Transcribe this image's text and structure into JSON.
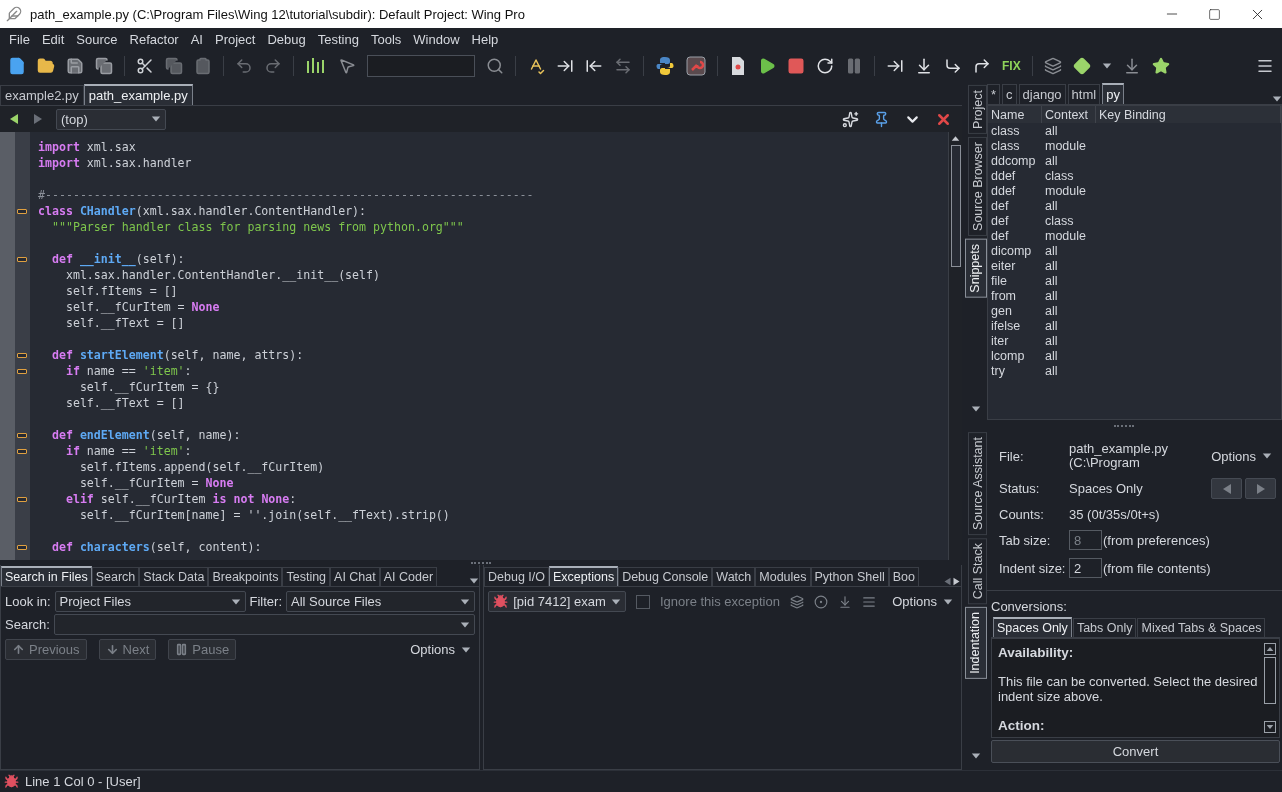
{
  "window": {
    "title": "path_example.py (C:\\Program Files\\Wing 12\\tutorial\\subdir): Default Project: Wing Pro"
  },
  "menu": [
    "File",
    "Edit",
    "Source",
    "Refactor",
    "AI",
    "Project",
    "Debug",
    "Testing",
    "Tools",
    "Window",
    "Help"
  ],
  "toolbar": {
    "fix_label": "FIX"
  },
  "editor": {
    "tabs": [
      {
        "label": "example2.py",
        "selected": false
      },
      {
        "label": "path_example.py",
        "selected": true
      }
    ],
    "scope": "(top)",
    "lines": [
      {
        "fold": false,
        "segments": [
          {
            "kind": "kw",
            "text": "import"
          },
          {
            "kind": "plain",
            "text": " xml.sax"
          }
        ]
      },
      {
        "fold": false,
        "segments": [
          {
            "kind": "kw",
            "text": "import"
          },
          {
            "kind": "plain",
            "text": " xml.sax.handler"
          }
        ]
      },
      {
        "fold": false
      },
      {
        "fold": false,
        "segments": [
          {
            "kind": "comment",
            "text": "#----------------------------------------------------------------------"
          }
        ]
      },
      {
        "fold": true,
        "segments": [
          {
            "kind": "kw",
            "text": "class "
          },
          {
            "kind": "fn",
            "text": "CHandler"
          },
          {
            "kind": "plain",
            "text": "(xml.sax.handler.ContentHandler):"
          }
        ]
      },
      {
        "fold": false,
        "segments": [
          {
            "kind": "str",
            "text": "  \"\"\"Parser handler class for parsing news from python.org\"\"\""
          }
        ]
      },
      {
        "fold": false
      },
      {
        "fold": true,
        "segments": [
          {
            "kind": "kw",
            "text": "  def "
          },
          {
            "kind": "fn",
            "text": "__init__"
          },
          {
            "kind": "plain",
            "text": "(self):"
          }
        ]
      },
      {
        "fold": false,
        "segments": [
          {
            "kind": "plain",
            "text": "    xml.sax.handler.ContentHandler.__init__(self)"
          }
        ]
      },
      {
        "fold": false,
        "segments": [
          {
            "kind": "plain",
            "text": "    self.fItems = []"
          }
        ]
      },
      {
        "fold": false,
        "segments": [
          {
            "kind": "plain",
            "text": "    self.__fCurItem = "
          },
          {
            "kind": "kw",
            "text": "None"
          }
        ]
      },
      {
        "fold": false,
        "segments": [
          {
            "kind": "plain",
            "text": "    self.__fText = []"
          }
        ]
      },
      {
        "fold": false
      },
      {
        "fold": true,
        "segments": [
          {
            "kind": "kw",
            "text": "  def "
          },
          {
            "kind": "fn",
            "text": "startElement"
          },
          {
            "kind": "plain",
            "text": "(self, name, attrs):"
          }
        ]
      },
      {
        "fold": true,
        "segments": [
          {
            "kind": "kw",
            "text": "    if"
          },
          {
            "kind": "plain",
            "text": " name == "
          },
          {
            "kind": "str",
            "text": "'item'"
          },
          {
            "kind": "plain",
            "text": ":"
          }
        ]
      },
      {
        "fold": false,
        "segments": [
          {
            "kind": "plain",
            "text": "      self.__fCurItem = {}"
          }
        ]
      },
      {
        "fold": false,
        "segments": [
          {
            "kind": "plain",
            "text": "    self.__fText = []"
          }
        ]
      },
      {
        "fold": false
      },
      {
        "fold": true,
        "segments": [
          {
            "kind": "kw",
            "text": "  def "
          },
          {
            "kind": "fn",
            "text": "endElement"
          },
          {
            "kind": "plain",
            "text": "(self, name):"
          }
        ]
      },
      {
        "fold": true,
        "segments": [
          {
            "kind": "kw",
            "text": "    if"
          },
          {
            "kind": "plain",
            "text": " name == "
          },
          {
            "kind": "str",
            "text": "'item'"
          },
          {
            "kind": "plain",
            "text": ":"
          }
        ]
      },
      {
        "fold": false,
        "segments": [
          {
            "kind": "plain",
            "text": "      self.fItems.append(self.__fCurItem)"
          }
        ]
      },
      {
        "fold": false,
        "segments": [
          {
            "kind": "plain",
            "text": "      self.__fCurItem = "
          },
          {
            "kind": "kw",
            "text": "None"
          }
        ]
      },
      {
        "fold": true,
        "segments": [
          {
            "kind": "kw",
            "text": "    elif"
          },
          {
            "kind": "plain",
            "text": " self.__fCurItem "
          },
          {
            "kind": "kw",
            "text": "is not None"
          },
          {
            "kind": "plain",
            "text": ":"
          }
        ]
      },
      {
        "fold": false,
        "segments": [
          {
            "kind": "plain",
            "text": "      self.__fCurItem[name] = ''.join(self.__fText).strip()"
          }
        ]
      },
      {
        "fold": false
      },
      {
        "fold": true,
        "segments": [
          {
            "kind": "kw",
            "text": "  def "
          },
          {
            "kind": "fn",
            "text": "characters"
          },
          {
            "kind": "plain",
            "text": "(self, content):"
          }
        ]
      }
    ]
  },
  "search_panel": {
    "tabs": [
      {
        "label": "Search in Files",
        "selected": true
      },
      {
        "label": "Search",
        "selected": false
      },
      {
        "label": "Stack Data",
        "selected": false
      },
      {
        "label": "Breakpoints",
        "selected": false
      },
      {
        "label": "Testing",
        "selected": false
      },
      {
        "label": "AI Chat",
        "selected": false
      },
      {
        "label": "AI Coder",
        "selected": false
      }
    ],
    "look_in_label": "Look in:",
    "look_in": "Project Files",
    "filter_label": "Filter:",
    "filter": "All Source Files",
    "search_label": "Search:",
    "buttons": [
      {
        "label": "Previous",
        "kind": "up",
        "disabled": true
      },
      {
        "label": "Next",
        "kind": "down",
        "disabled": true
      },
      {
        "label": "Pause",
        "kind": "pause",
        "disabled": true
      }
    ],
    "options": "Options"
  },
  "debug_panel": {
    "tabs": [
      {
        "label": "Debug I/O",
        "selected": false
      },
      {
        "label": "Exceptions",
        "selected": true
      },
      {
        "label": "Debug Console",
        "selected": false
      },
      {
        "label": "Watch",
        "selected": false
      },
      {
        "label": "Modules",
        "selected": false
      },
      {
        "label": "Python Shell",
        "selected": false
      },
      {
        "label": "Boo",
        "selected": false
      }
    ],
    "process": "[pid 7412] exam",
    "ignore": {
      "label": "Ignore this exception",
      "checked": false,
      "disabled": true
    },
    "options": "Options"
  },
  "snippets": {
    "side_tabs": [
      {
        "label": "Project",
        "selected": false
      },
      {
        "label": "Source Browser",
        "selected": false
      },
      {
        "label": "Snippets",
        "selected": true
      }
    ],
    "tabs": [
      {
        "label": "*",
        "selected": false
      },
      {
        "label": "c",
        "selected": false
      },
      {
        "label": "django",
        "selected": false
      },
      {
        "label": "html",
        "selected": false
      },
      {
        "label": "py",
        "selected": true
      }
    ],
    "columns": [
      "Name",
      "Context",
      "Key Binding"
    ],
    "rows": [
      {
        "name": "class",
        "context": "all"
      },
      {
        "name": "class",
        "context": "module"
      },
      {
        "name": "ddcomp",
        "context": "all"
      },
      {
        "name": "ddef",
        "context": "class"
      },
      {
        "name": "ddef",
        "context": "module"
      },
      {
        "name": "def",
        "context": "all"
      },
      {
        "name": "def",
        "context": "class"
      },
      {
        "name": "def",
        "context": "module"
      },
      {
        "name": "dicomp",
        "context": "all"
      },
      {
        "name": "eiter",
        "context": "all"
      },
      {
        "name": "file",
        "context": "all"
      },
      {
        "name": "from",
        "context": "all"
      },
      {
        "name": "gen",
        "context": "all"
      },
      {
        "name": "ifelse",
        "context": "all"
      },
      {
        "name": "iter",
        "context": "all"
      },
      {
        "name": "lcomp",
        "context": "all"
      },
      {
        "name": "try",
        "context": "all"
      }
    ]
  },
  "indentation": {
    "side_tabs": [
      {
        "label": "Source Assistant",
        "selected": false
      },
      {
        "label": "Call Stack",
        "selected": false
      },
      {
        "label": "Indentation",
        "selected": true
      }
    ],
    "file_label": "File:",
    "file": "path_example.py (C:\\Program",
    "options": "Options",
    "status_label": "Status:",
    "status": "Spaces Only",
    "counts_label": "Counts:",
    "counts": "35 (0t/35s/0t+s)",
    "fields": [
      {
        "label": "Tab size:",
        "value": "8",
        "note": "(from preferences)",
        "disabled": true
      },
      {
        "label": "Indent size:",
        "value": "2",
        "note": "(from file contents)",
        "disabled": false
      }
    ],
    "conversions_label": "Conversions:",
    "conversion_tabs": [
      {
        "label": "Spaces Only",
        "selected": true
      },
      {
        "label": "Tabs Only",
        "selected": false
      },
      {
        "label": "Mixed Tabs & Spaces",
        "selected": false
      }
    ],
    "availability_heading": "Availability:",
    "availability_text": "This file can be converted. Select the desired indent size above.",
    "action_heading": "Action:",
    "convert_button": "Convert"
  },
  "status_bar": {
    "text": "Line 1 Col 0 - [User]"
  }
}
